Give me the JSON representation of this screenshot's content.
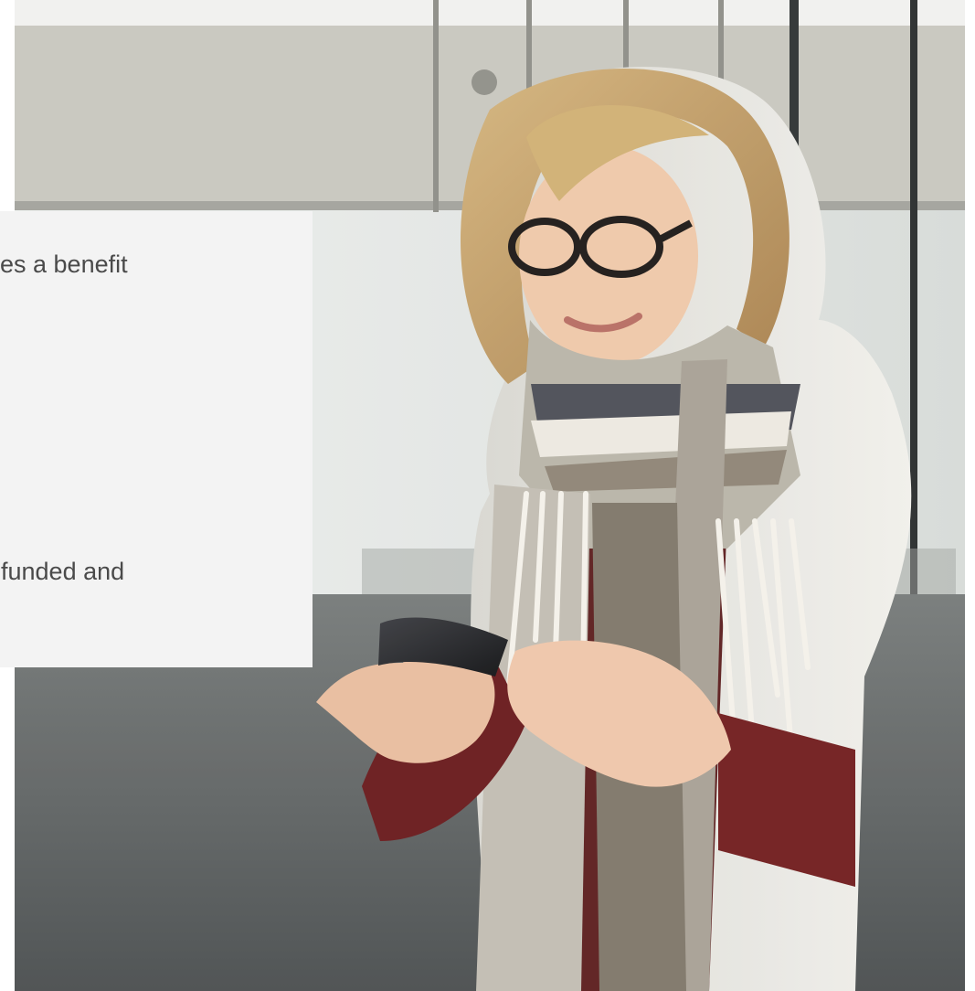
{
  "card": {
    "line_1": "es a benefit",
    "line_2": "funded and"
  },
  "photo": {
    "subject": "Woman with glasses and striped scarf looking at smartphone"
  },
  "colors": {
    "card_background": "#f3f3f3",
    "text": "#4a4a4a",
    "scarf_stripe": "#3b3d44",
    "shirt": "#5d1f1f",
    "jacket": "#e6e5df"
  }
}
